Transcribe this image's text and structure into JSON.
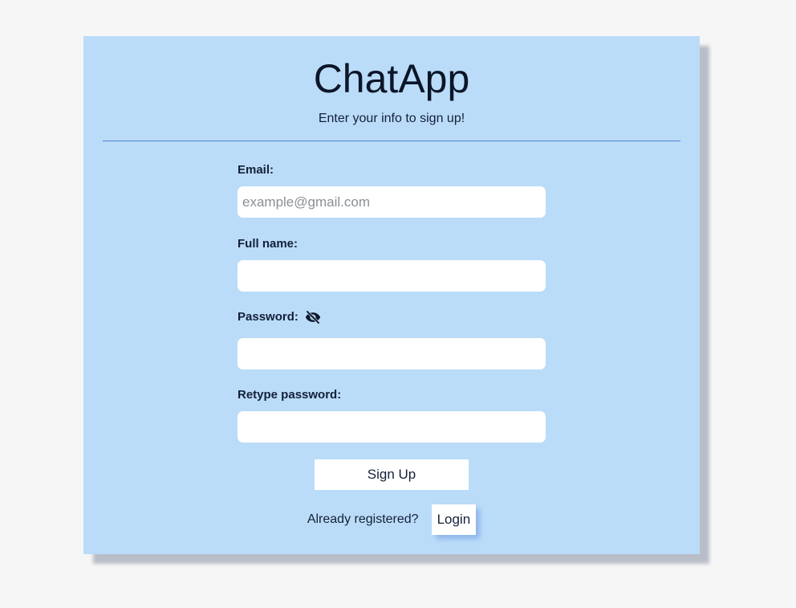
{
  "app": {
    "title": "ChatApp",
    "subtitle": "Enter your info to sign up!"
  },
  "form": {
    "email": {
      "label": "Email:",
      "value": "",
      "placeholder": "example@gmail.com"
    },
    "full_name": {
      "label": "Full name:",
      "value": "",
      "placeholder": ""
    },
    "password": {
      "label": "Password:",
      "value": "",
      "toggle_icon": "eye-slash-icon"
    },
    "retype_password": {
      "label": "Retype password:",
      "value": ""
    },
    "signup_label": "Sign Up"
  },
  "footer": {
    "prompt": "Already registered?",
    "login_label": "Login"
  },
  "colors": {
    "page_background": "#f6f6f6",
    "card_background": "#bbdcf8",
    "divider": "#4e86d4",
    "text": "#13203a"
  }
}
